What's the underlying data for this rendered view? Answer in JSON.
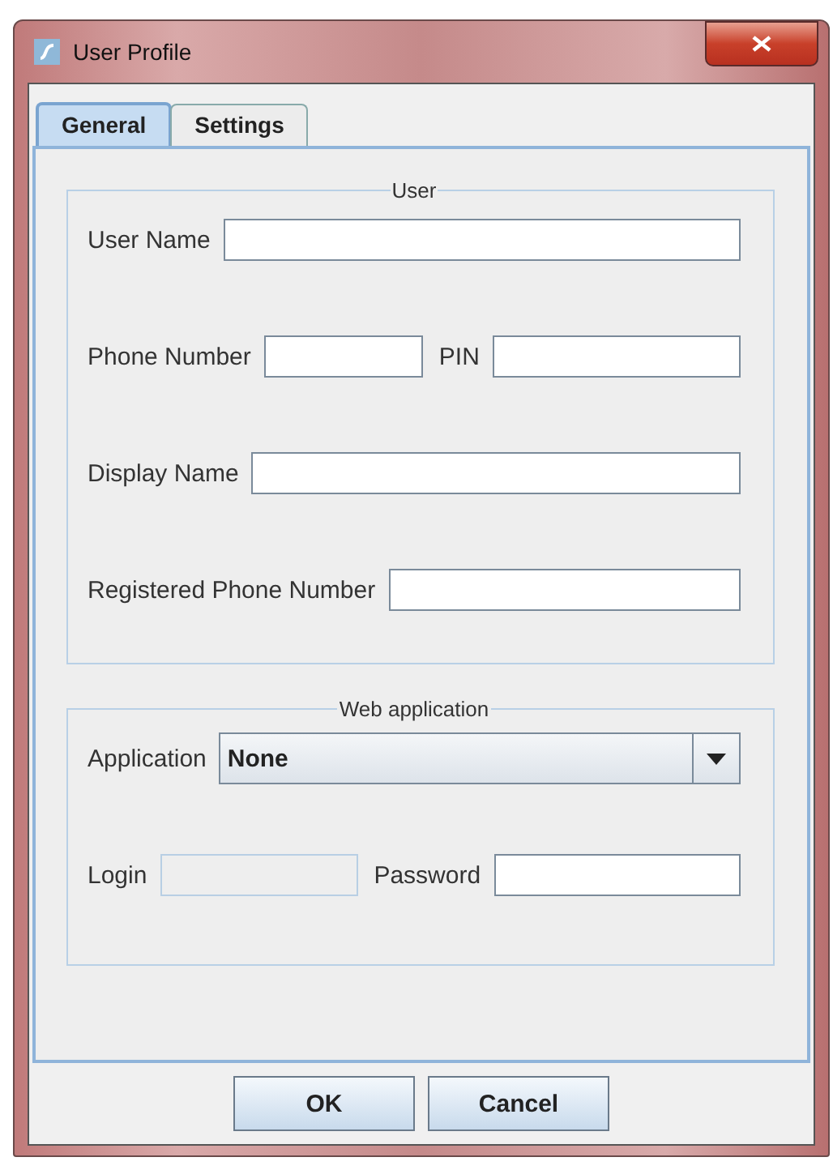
{
  "window": {
    "title": "User Profile"
  },
  "tabs": [
    {
      "label": "General",
      "selected": true
    },
    {
      "label": "Settings",
      "selected": false
    }
  ],
  "user_group": {
    "title": "User",
    "rows": [
      [
        {
          "label": "User Name",
          "disabled": false
        }
      ],
      [
        {
          "label": "Phone Number",
          "disabled": false
        },
        {
          "label": "PIN",
          "disabled": false
        }
      ],
      [
        {
          "label": "Display Name",
          "disabled": false
        }
      ],
      [
        {
          "label": "Registered Phone Number",
          "disabled": false
        }
      ]
    ]
  },
  "web_group": {
    "title": "Web application",
    "application": {
      "label": "Application",
      "value": "None"
    },
    "credentials": [
      {
        "label": "Login",
        "disabled": true
      },
      {
        "label": "Password",
        "disabled": false
      }
    ]
  },
  "buttons": [
    "OK",
    "Cancel"
  ]
}
